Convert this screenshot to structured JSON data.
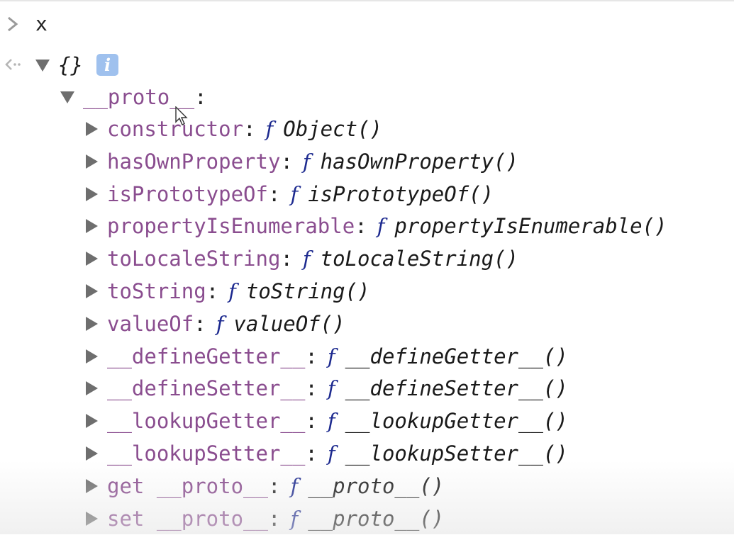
{
  "input": {
    "text": "x"
  },
  "result": {
    "summary": "{}",
    "info_badge": "i",
    "proto": {
      "label": "__proto__",
      "colon": ":"
    }
  },
  "properties": [
    {
      "key": "constructor",
      "f": "f",
      "value": "Object()"
    },
    {
      "key": "hasOwnProperty",
      "f": "f",
      "value": "hasOwnProperty()"
    },
    {
      "key": "isPrototypeOf",
      "f": "f",
      "value": "isPrototypeOf()"
    },
    {
      "key": "propertyIsEnumerable",
      "f": "f",
      "value": "propertyIsEnumerable()"
    },
    {
      "key": "toLocaleString",
      "f": "f",
      "value": "toLocaleString()"
    },
    {
      "key": "toString",
      "f": "f",
      "value": "toString()"
    },
    {
      "key": "valueOf",
      "f": "f",
      "value": "valueOf()"
    },
    {
      "key": "__defineGetter__",
      "f": "f",
      "value": "__defineGetter__()"
    },
    {
      "key": "__defineSetter__",
      "f": "f",
      "value": "__defineSetter__()"
    },
    {
      "key": "__lookupGetter__",
      "f": "f",
      "value": "__lookupGetter__()"
    },
    {
      "key": "__lookupSetter__",
      "f": "f",
      "value": "__lookupSetter__()"
    },
    {
      "key": "get __proto__",
      "f": "f",
      "value": "__proto__()"
    },
    {
      "key": "set __proto__",
      "f": "f",
      "value": "__proto__()"
    }
  ],
  "colors": {
    "property_key": "#8a4d8f",
    "function_f": "#1d2a8f",
    "value_text": "#1a1a1a",
    "triangle": "#6e6e6e",
    "info_badge_bg": "#9fc1ee"
  },
  "icons": {
    "prompt": "chevron-right-icon",
    "return": "return-arrow-icon",
    "info": "info-icon",
    "expand": "triangle-right-icon",
    "collapse": "triangle-down-icon",
    "cursor": "mouse-pointer-icon"
  }
}
